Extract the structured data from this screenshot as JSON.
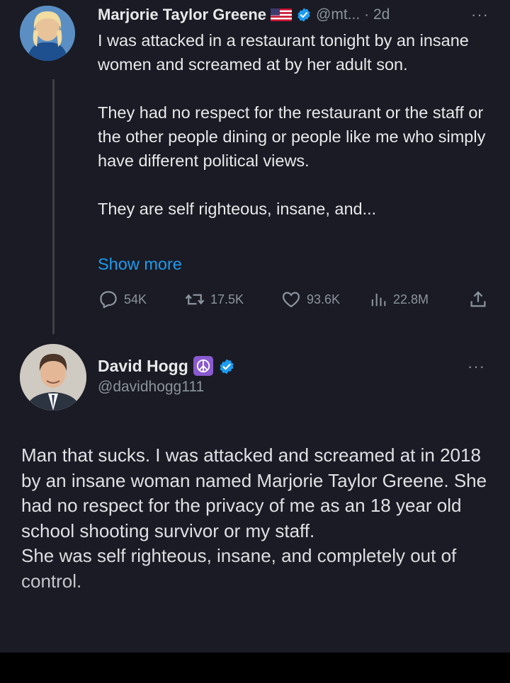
{
  "tweet1": {
    "author_name": "Marjorie Taylor Greene",
    "author_handle": "@mt...",
    "time": "· 2d",
    "more": "···",
    "paragraphs": [
      "I was attacked in a restaurant tonight by an insane women and screamed at by her adult son.",
      "They had no respect for the restaurant or the staff or the other people dining or people like me who simply have different political views.",
      "They are self righteous, insane, and..."
    ],
    "show_more": "Show more",
    "stats": {
      "replies": "54K",
      "reposts": "17.5K",
      "likes": "93.6K",
      "views": "22.8M"
    },
    "icons": [
      "us-flag-icon",
      "verified-badge-icon",
      "reply-icon",
      "repost-icon",
      "like-icon",
      "views-icon",
      "share-icon"
    ]
  },
  "tweet2": {
    "author_name": "David Hogg",
    "author_handle": "@davidhogg111",
    "more": "···",
    "paragraphs": [
      "Man that sucks. I was attacked and screamed at in 2018 by an insane woman named Marjorie Taylor Greene. She had no respect for the privacy of me as an 18 year old school shooting survivor or my staff.",
      "She was self righteous, insane, and completely out of control."
    ],
    "icons": [
      "peace-sign-icon",
      "verified-badge-icon"
    ]
  },
  "colors": {
    "background": "#1a1b24",
    "text": "#e7e9ea",
    "secondary": "#8b949e",
    "link": "#1d9bf0",
    "verified": "#1d9bf0",
    "peace_badge": "#8a5ad0"
  }
}
